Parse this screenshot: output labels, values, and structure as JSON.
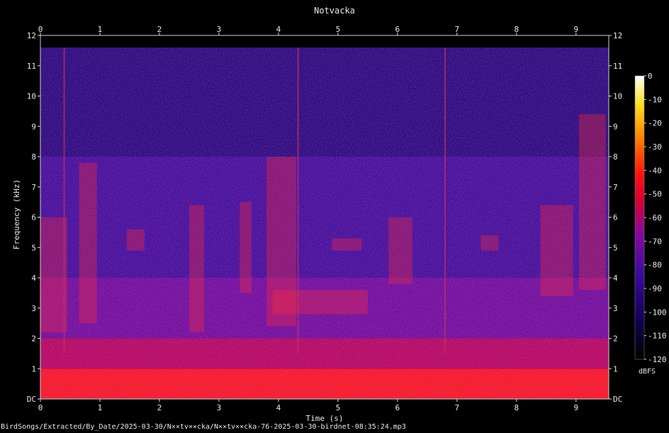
{
  "chart_data": {
    "type": "heatmap",
    "title": "Notvacka",
    "xlabel": "Time (s)",
    "ylabel": "Frequency (kHz)",
    "xlim": [
      0,
      9.55
    ],
    "ylim": [
      0,
      12
    ],
    "x_ticks": [
      "0",
      "1",
      "2",
      "3",
      "4",
      "5",
      "6",
      "7",
      "8",
      "9"
    ],
    "y_ticks": [
      "DC",
      "1",
      "2",
      "3",
      "4",
      "5",
      "6",
      "7",
      "8",
      "9",
      "10",
      "11",
      "12"
    ],
    "colorbar": {
      "unit": "dBFS",
      "range": [
        -120,
        0
      ],
      "ticks": [
        "0",
        "-10",
        "-20",
        "-30",
        "-40",
        "-50",
        "-60",
        "-70",
        "-80",
        "-90",
        "-100",
        "-110",
        "-120"
      ]
    },
    "energy_bands_khz_db": [
      {
        "from": 0,
        "to": 1,
        "db": -55
      },
      {
        "from": 1,
        "to": 2,
        "db": -70
      },
      {
        "from": 2,
        "to": 4,
        "db": -82
      },
      {
        "from": 4,
        "to": 8,
        "db": -92
      },
      {
        "from": 8,
        "to": 11.6,
        "db": -100
      }
    ],
    "calls": [
      {
        "t": 0.0,
        "t_end": 0.45,
        "f_low": 2.2,
        "f_high": 6.0
      },
      {
        "t": 0.65,
        "t_end": 0.95,
        "f_low": 2.5,
        "f_high": 7.8
      },
      {
        "t": 1.45,
        "t_end": 1.75,
        "f_low": 4.9,
        "f_high": 5.6
      },
      {
        "t": 2.5,
        "t_end": 2.75,
        "f_low": 2.2,
        "f_high": 6.4
      },
      {
        "t": 3.35,
        "t_end": 3.55,
        "f_low": 3.5,
        "f_high": 6.5
      },
      {
        "t": 3.8,
        "t_end": 4.3,
        "f_low": 2.4,
        "f_high": 8.0
      },
      {
        "t": 3.9,
        "t_end": 5.5,
        "f_low": 2.8,
        "f_high": 3.6
      },
      {
        "t": 4.9,
        "t_end": 5.4,
        "f_low": 4.9,
        "f_high": 5.3
      },
      {
        "t": 5.85,
        "t_end": 6.25,
        "f_low": 3.8,
        "f_high": 6.0
      },
      {
        "t": 7.4,
        "t_end": 7.7,
        "f_low": 4.9,
        "f_high": 5.4
      },
      {
        "t": 8.4,
        "t_end": 8.95,
        "f_low": 3.4,
        "f_high": 6.4
      },
      {
        "t": 9.05,
        "t_end": 9.5,
        "f_low": 3.6,
        "f_high": 9.4
      }
    ],
    "clicks": [
      0.4,
      4.33,
      6.8
    ]
  },
  "footer": {
    "filename": "BirdSongs/Extracted/By_Date/2025-03-30/N××tv××cka/N××tv××cka-76-2025-03-30-birdnet-08:35:24.mp3"
  }
}
